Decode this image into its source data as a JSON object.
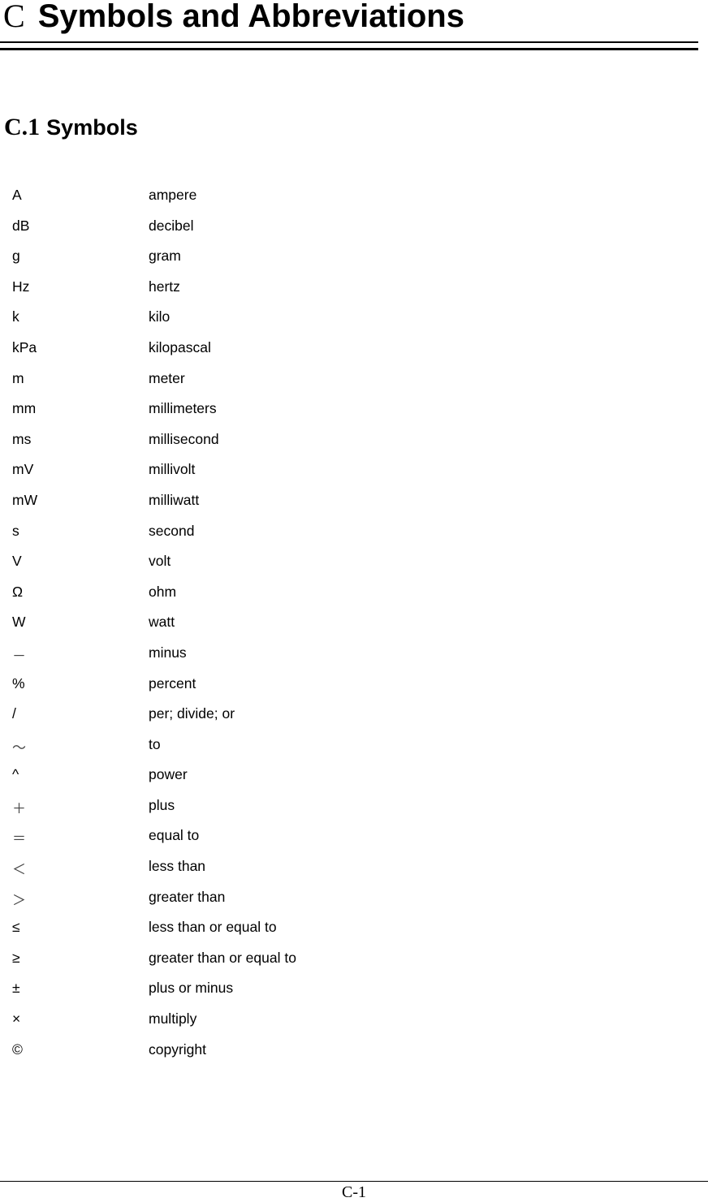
{
  "header": {
    "appendix_letter": "C",
    "title": "Symbols and Abbreviations"
  },
  "section": {
    "number": "C.1",
    "title": "Symbols"
  },
  "symbols": [
    {
      "symbol": "A",
      "meaning": "ampere"
    },
    {
      "symbol": "dB",
      "meaning": "decibel"
    },
    {
      "symbol": "g",
      "meaning": "gram"
    },
    {
      "symbol": "Hz",
      "meaning": "hertz"
    },
    {
      "symbol": "k",
      "meaning": "kilo"
    },
    {
      "symbol": "kPa",
      "meaning": "kilopascal"
    },
    {
      "symbol": "m",
      "meaning": "meter"
    },
    {
      "symbol": "mm",
      "meaning": "millimeters"
    },
    {
      "symbol": "ms",
      "meaning": "millisecond"
    },
    {
      "symbol": "mV",
      "meaning": "millivolt"
    },
    {
      "symbol": "mW",
      "meaning": "milliwatt"
    },
    {
      "symbol": "s",
      "meaning": "second"
    },
    {
      "symbol": "V",
      "meaning": "volt"
    },
    {
      "symbol": "Ω",
      "meaning": "ohm"
    },
    {
      "symbol": "W",
      "meaning": "watt"
    },
    {
      "symbol": "－",
      "meaning": "minus"
    },
    {
      "symbol": "%",
      "meaning": "percent"
    },
    {
      "symbol": "/",
      "meaning": "per; divide; or"
    },
    {
      "symbol": "～",
      "meaning": "to"
    },
    {
      "symbol": "^",
      "meaning": "power"
    },
    {
      "symbol": "＋",
      "meaning": "plus"
    },
    {
      "symbol": "＝",
      "meaning": "equal to"
    },
    {
      "symbol": "＜",
      "meaning": "less than"
    },
    {
      "symbol": "＞",
      "meaning": "greater than"
    },
    {
      "symbol": "≤",
      "meaning": "less than or equal to"
    },
    {
      "symbol": "≥",
      "meaning": "greater than or equal to"
    },
    {
      "symbol": "±",
      "meaning": "plus or minus"
    },
    {
      "symbol": "×",
      "meaning": "multiply"
    },
    {
      "symbol": "©",
      "meaning": "copyright"
    }
  ],
  "footer": {
    "page_number": "C-1"
  }
}
